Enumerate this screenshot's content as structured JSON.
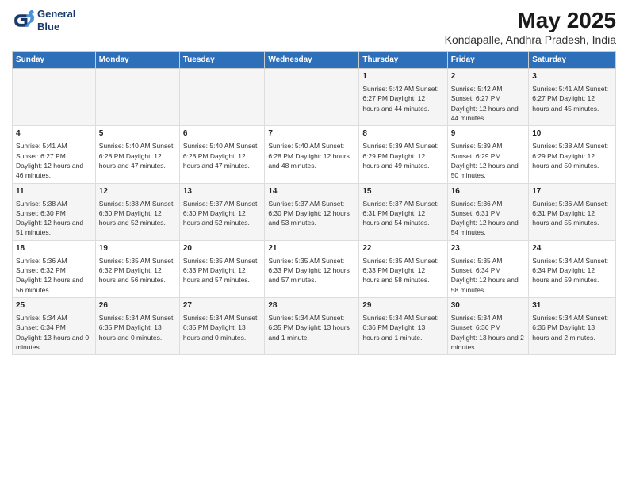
{
  "header": {
    "logo_line1": "General",
    "logo_line2": "Blue",
    "title": "May 2025",
    "subtitle": "Kondapalle, Andhra Pradesh, India"
  },
  "columns": [
    "Sunday",
    "Monday",
    "Tuesday",
    "Wednesday",
    "Thursday",
    "Friday",
    "Saturday"
  ],
  "weeks": [
    [
      {
        "day": "",
        "info": ""
      },
      {
        "day": "",
        "info": ""
      },
      {
        "day": "",
        "info": ""
      },
      {
        "day": "",
        "info": ""
      },
      {
        "day": "1",
        "info": "Sunrise: 5:42 AM\nSunset: 6:27 PM\nDaylight: 12 hours\nand 44 minutes."
      },
      {
        "day": "2",
        "info": "Sunrise: 5:42 AM\nSunset: 6:27 PM\nDaylight: 12 hours\nand 44 minutes."
      },
      {
        "day": "3",
        "info": "Sunrise: 5:41 AM\nSunset: 6:27 PM\nDaylight: 12 hours\nand 45 minutes."
      }
    ],
    [
      {
        "day": "4",
        "info": "Sunrise: 5:41 AM\nSunset: 6:27 PM\nDaylight: 12 hours\nand 46 minutes."
      },
      {
        "day": "5",
        "info": "Sunrise: 5:40 AM\nSunset: 6:28 PM\nDaylight: 12 hours\nand 47 minutes."
      },
      {
        "day": "6",
        "info": "Sunrise: 5:40 AM\nSunset: 6:28 PM\nDaylight: 12 hours\nand 47 minutes."
      },
      {
        "day": "7",
        "info": "Sunrise: 5:40 AM\nSunset: 6:28 PM\nDaylight: 12 hours\nand 48 minutes."
      },
      {
        "day": "8",
        "info": "Sunrise: 5:39 AM\nSunset: 6:29 PM\nDaylight: 12 hours\nand 49 minutes."
      },
      {
        "day": "9",
        "info": "Sunrise: 5:39 AM\nSunset: 6:29 PM\nDaylight: 12 hours\nand 50 minutes."
      },
      {
        "day": "10",
        "info": "Sunrise: 5:38 AM\nSunset: 6:29 PM\nDaylight: 12 hours\nand 50 minutes."
      }
    ],
    [
      {
        "day": "11",
        "info": "Sunrise: 5:38 AM\nSunset: 6:30 PM\nDaylight: 12 hours\nand 51 minutes."
      },
      {
        "day": "12",
        "info": "Sunrise: 5:38 AM\nSunset: 6:30 PM\nDaylight: 12 hours\nand 52 minutes."
      },
      {
        "day": "13",
        "info": "Sunrise: 5:37 AM\nSunset: 6:30 PM\nDaylight: 12 hours\nand 52 minutes."
      },
      {
        "day": "14",
        "info": "Sunrise: 5:37 AM\nSunset: 6:30 PM\nDaylight: 12 hours\nand 53 minutes."
      },
      {
        "day": "15",
        "info": "Sunrise: 5:37 AM\nSunset: 6:31 PM\nDaylight: 12 hours\nand 54 minutes."
      },
      {
        "day": "16",
        "info": "Sunrise: 5:36 AM\nSunset: 6:31 PM\nDaylight: 12 hours\nand 54 minutes."
      },
      {
        "day": "17",
        "info": "Sunrise: 5:36 AM\nSunset: 6:31 PM\nDaylight: 12 hours\nand 55 minutes."
      }
    ],
    [
      {
        "day": "18",
        "info": "Sunrise: 5:36 AM\nSunset: 6:32 PM\nDaylight: 12 hours\nand 56 minutes."
      },
      {
        "day": "19",
        "info": "Sunrise: 5:35 AM\nSunset: 6:32 PM\nDaylight: 12 hours\nand 56 minutes."
      },
      {
        "day": "20",
        "info": "Sunrise: 5:35 AM\nSunset: 6:33 PM\nDaylight: 12 hours\nand 57 minutes."
      },
      {
        "day": "21",
        "info": "Sunrise: 5:35 AM\nSunset: 6:33 PM\nDaylight: 12 hours\nand 57 minutes."
      },
      {
        "day": "22",
        "info": "Sunrise: 5:35 AM\nSunset: 6:33 PM\nDaylight: 12 hours\nand 58 minutes."
      },
      {
        "day": "23",
        "info": "Sunrise: 5:35 AM\nSunset: 6:34 PM\nDaylight: 12 hours\nand 58 minutes."
      },
      {
        "day": "24",
        "info": "Sunrise: 5:34 AM\nSunset: 6:34 PM\nDaylight: 12 hours\nand 59 minutes."
      }
    ],
    [
      {
        "day": "25",
        "info": "Sunrise: 5:34 AM\nSunset: 6:34 PM\nDaylight: 13 hours\nand 0 minutes."
      },
      {
        "day": "26",
        "info": "Sunrise: 5:34 AM\nSunset: 6:35 PM\nDaylight: 13 hours\nand 0 minutes."
      },
      {
        "day": "27",
        "info": "Sunrise: 5:34 AM\nSunset: 6:35 PM\nDaylight: 13 hours\nand 0 minutes."
      },
      {
        "day": "28",
        "info": "Sunrise: 5:34 AM\nSunset: 6:35 PM\nDaylight: 13 hours\nand 1 minute."
      },
      {
        "day": "29",
        "info": "Sunrise: 5:34 AM\nSunset: 6:36 PM\nDaylight: 13 hours\nand 1 minute."
      },
      {
        "day": "30",
        "info": "Sunrise: 5:34 AM\nSunset: 6:36 PM\nDaylight: 13 hours\nand 2 minutes."
      },
      {
        "day": "31",
        "info": "Sunrise: 5:34 AM\nSunset: 6:36 PM\nDaylight: 13 hours\nand 2 minutes."
      }
    ]
  ]
}
